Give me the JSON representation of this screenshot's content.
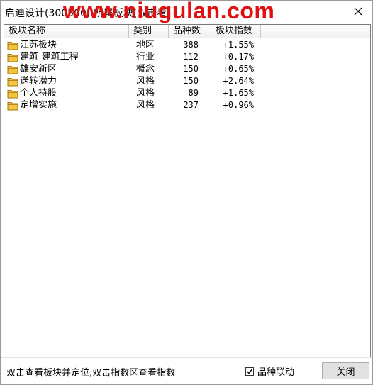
{
  "window": {
    "title": "启迪设计(300500) 所属板块(双击看)",
    "watermark": "www.niugulan.com"
  },
  "table": {
    "columns": [
      "板块名称",
      "类别",
      "品种数",
      "板块指数"
    ],
    "rows": [
      {
        "name": "江苏板块",
        "type": "地区",
        "count": "388",
        "index": "+1.55%"
      },
      {
        "name": "建筑-建筑工程",
        "type": "行业",
        "count": "112",
        "index": "+0.17%"
      },
      {
        "name": "雄安新区",
        "type": "概念",
        "count": "150",
        "index": "+0.65%"
      },
      {
        "name": "送转潜力",
        "type": "风格",
        "count": "150",
        "index": "+2.64%"
      },
      {
        "name": "个人持股",
        "type": "风格",
        "count": "89",
        "index": "+1.65%"
      },
      {
        "name": "定增实施",
        "type": "风格",
        "count": "237",
        "index": "+0.96%"
      }
    ]
  },
  "footer": {
    "hint": "双击查看板块并定位,双击指数区查看指数",
    "checkbox_label": "品种联动",
    "checkbox_checked": true,
    "close_label": "关闭"
  },
  "colors": {
    "watermark": "#e01010",
    "folder": "#f5c542"
  },
  "icons": {
    "row_icon": "folder-icon",
    "title_close": "close-icon",
    "checkbox": "checkmark-icon"
  }
}
